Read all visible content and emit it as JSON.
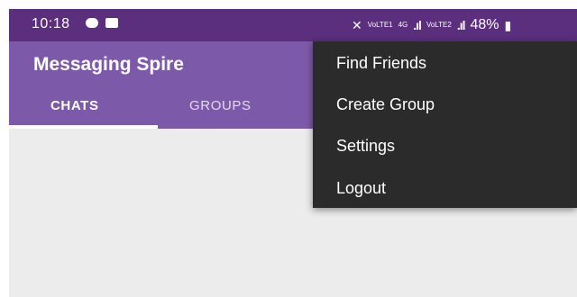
{
  "status_bar": {
    "time": "10:18",
    "network_lte1": "VoLTE1",
    "network_4g": "4G",
    "network_lte2": "VoLTE2",
    "battery": "48%"
  },
  "app": {
    "title": "Messaging Spire",
    "tabs": [
      {
        "label": "CHATS",
        "selected": true
      },
      {
        "label": "GROUPS",
        "selected": false
      }
    ]
  },
  "overflow_menu": {
    "items": [
      {
        "label": "Find Friends"
      },
      {
        "label": "Create Group"
      },
      {
        "label": "Settings"
      },
      {
        "label": "Logout"
      }
    ]
  },
  "colors": {
    "status_bar": "#5b2e7e",
    "app_bar": "#7d59a9",
    "menu_bg": "#2b2b2b",
    "content_bg": "#ececec"
  }
}
